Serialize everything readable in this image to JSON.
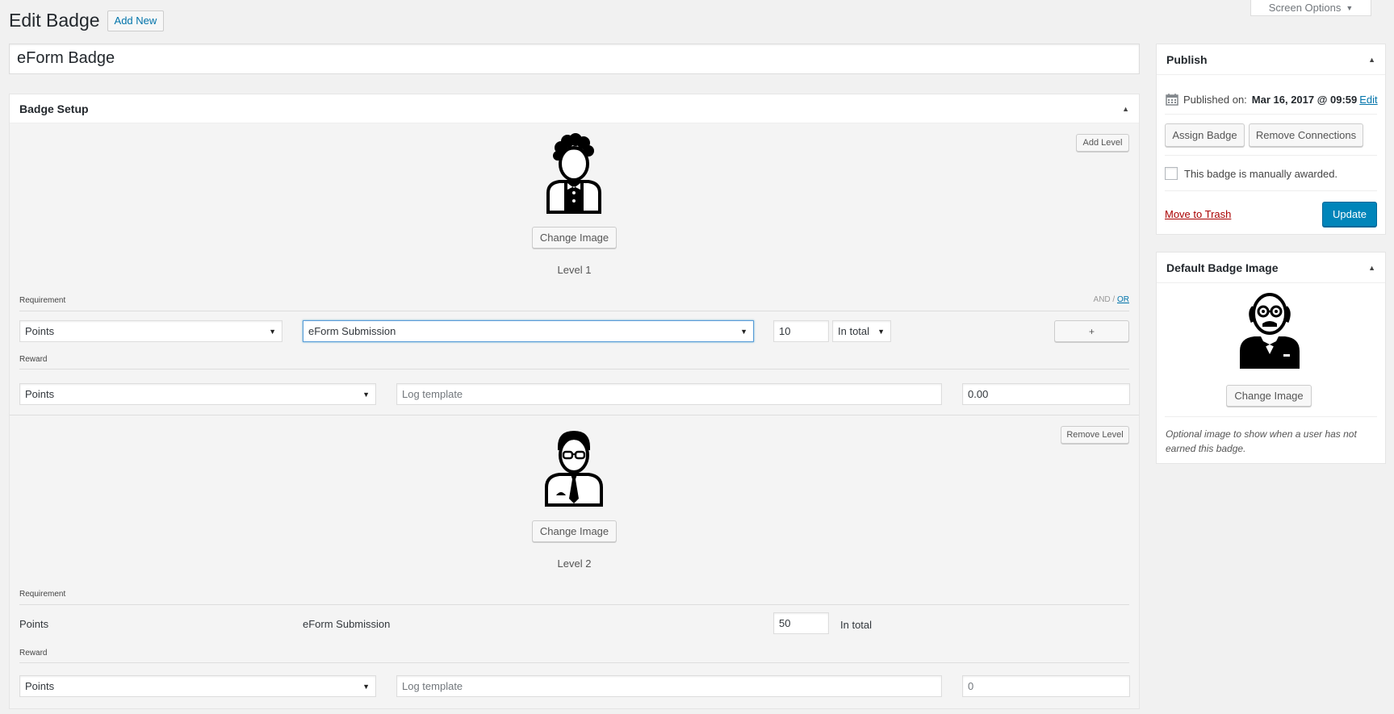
{
  "header": {
    "screen_options": "Screen Options",
    "title": "Edit Badge",
    "add_new": "Add New"
  },
  "post_title": "eForm Badge",
  "badge_setup": {
    "title": "Badge Setup",
    "add_level": "Add Level",
    "remove_level": "Remove Level",
    "change_image": "Change Image",
    "requirement_label": "Requirement",
    "reward_label": "Reward",
    "and_label": "AND",
    "or_label": "OR",
    "plus_label": "+",
    "levels": [
      {
        "label": "Level 1",
        "requirement": {
          "type": "Points",
          "event": "eForm Submission",
          "count": "10",
          "period": "In total"
        },
        "reward": {
          "type": "Points",
          "log_placeholder": "Log template",
          "amount": "0.00"
        }
      },
      {
        "label": "Level 2",
        "requirement": {
          "type": "Points",
          "event": "eForm Submission",
          "count": "50",
          "period": "In total"
        },
        "reward": {
          "type": "Points",
          "log_placeholder": "Log template",
          "amount": "0"
        }
      }
    ]
  },
  "publish": {
    "title": "Publish",
    "published_on_label": "Published on:",
    "published_on_value": "Mar 16, 2017 @ 09:59",
    "edit": "Edit",
    "assign_badge": "Assign Badge",
    "remove_connections": "Remove Connections",
    "manual_label": "This badge is manually awarded.",
    "move_to_trash": "Move to Trash",
    "update": "Update"
  },
  "default_badge_image": {
    "title": "Default Badge Image",
    "change_image": "Change Image",
    "note": "Optional image to show when a user has not earned this badge."
  },
  "icons": {
    "collapse": "triangle-up-icon",
    "dropdown": "triangle-down-icon",
    "calendar": "calendar-icon"
  },
  "colors": {
    "primary": "#0085ba",
    "link": "#0073aa",
    "trash": "#aa0000"
  }
}
